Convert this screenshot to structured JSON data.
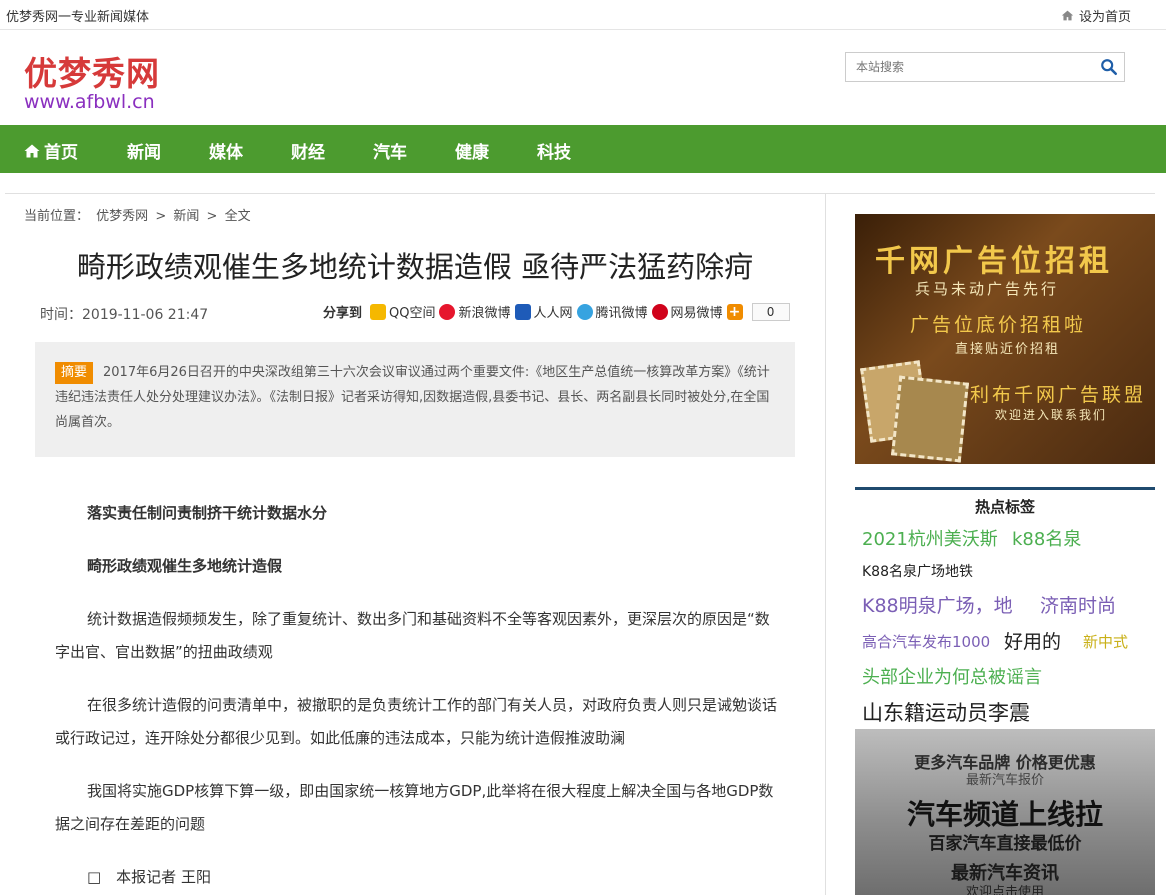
{
  "topbar": {
    "tagline": "优梦秀网一专业新闻媒体",
    "set_home": "设为首页"
  },
  "header": {
    "logo": "优梦秀网",
    "url": "www.afbwl.cn",
    "search_placeholder": "本站搜索"
  },
  "nav": {
    "items": [
      "首页",
      "新闻",
      "媒体",
      "财经",
      "汽车",
      "健康",
      "科技"
    ]
  },
  "breadcrumb": {
    "label": "当前位置：",
    "path": [
      "优梦秀网",
      ">",
      "新闻",
      ">",
      "全文"
    ]
  },
  "article": {
    "title": "畸形政绩观催生多地统计数据造假 亟待严法猛药除疴",
    "time": "时间：2019-11-06 21:47",
    "share_label": "分享到",
    "share_items": [
      "QQ空间",
      "新浪微博",
      "人人网",
      "腾讯微博",
      "网易微博"
    ],
    "share_count": "0",
    "summary_badge": "摘要",
    "summary": "2017年6月26日召开的中央深改组第三十六次会议审议通过两个重要文件:《地区生产总值统一核算改革方案》《统计违纪违法责任人处分处理建议办法》。《法制日报》记者采访得知,因数据造假,县委书记、县长、两名副县长同时被处分,在全国尚属首次。",
    "paragraphs": [
      "落实责任制问责制挤干统计数据水分",
      "畸形政绩观催生多地统计造假",
      "统计数据造假频频发生，除了重复统计、数出多门和基础资料不全等客观因素外，更深层次的原因是“数字出官、官出数据”的扭曲政绩观",
      "在很多统计造假的问责清单中，被撤职的是负责统计工作的部门有关人员，对政府负责人则只是诫勉谈话或行政记过，连开除处分都很少见到。如此低廉的违法成本，只能为统计造假推波助澜",
      "我国将实施GDP核算下算一级，即由国家统一核算地方GDP,此举将在很大程度上解决全国与各地GDP数据之间存在差距的问题",
      "□　本报记者 王阳"
    ]
  },
  "sidebar": {
    "ad1": {
      "line1": "千网广告位招租",
      "line2": "兵马未动广告先行",
      "line3": "广告位底价招租啦",
      "line4": "直接贴近价招租",
      "line5": "利布千网广告联盟",
      "line6": "欢迎进入联系我们"
    },
    "hot_title": "热点标签",
    "tags": [
      {
        "text": "2021杭州美沃斯",
        "color": "#4caf50"
      },
      {
        "text": "k88名泉",
        "color": "#4caf50"
      },
      {
        "text": "K88名泉广场地铁",
        "color": "#222222"
      },
      {
        "text": "K88明泉广场，地",
        "color": "#7b5fb5"
      },
      {
        "text": "济南时尚",
        "color": "#7b5fb5"
      },
      {
        "text": "高合汽车发布1000",
        "color": "#7b5fb5"
      },
      {
        "text": "好用的",
        "color": "#222222"
      },
      {
        "text": "新中式",
        "color": "#c9b018"
      },
      {
        "text": "头部企业为何总被谣言",
        "color": "#4caf50"
      },
      {
        "text": "山东籍运动员李震",
        "color": "#222222"
      }
    ],
    "ad2": {
      "line1": "更多汽车品牌 价格更优惠",
      "line2": "最新汽车报价",
      "line3": "汽车频道上线拉",
      "line4": "百家汽车直接最低价",
      "line5": "最新汽车资讯",
      "line6": "欢迎点击使用"
    }
  }
}
